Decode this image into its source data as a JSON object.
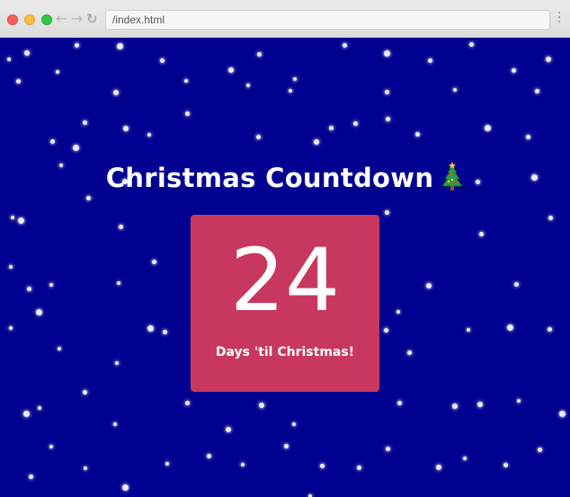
{
  "browser": {
    "url": "/index.html"
  },
  "page": {
    "title": "Christmas Countdown",
    "title_icon": "christmas-tree-icon",
    "countdown_value": "24",
    "countdown_label": "Days 'til Christmas!"
  },
  "colors": {
    "background": "#000090",
    "card": "#c8385e",
    "text": "#ffffff",
    "snow": "#e8ecff"
  }
}
